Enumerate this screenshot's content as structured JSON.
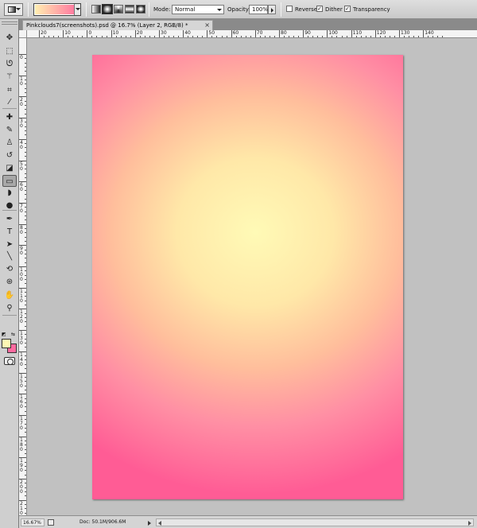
{
  "options_bar": {
    "tool_preset_icon": "gradient-tool-icon",
    "gradient_picker": {
      "start_color": "#ffeeb0",
      "end_color": "#ff7aa0"
    },
    "gradient_types": [
      "linear",
      "radial",
      "angle",
      "reflected",
      "diamond"
    ],
    "selected_gradient_type": "radial",
    "mode_label": "Mode:",
    "mode_value": "Normal",
    "opacity_label": "Opacity:",
    "opacity_value": "100%",
    "reverse_label": "Reverse",
    "reverse_checked": false,
    "dither_label": "Dither",
    "dither_checked": true,
    "transparency_label": "Transparency",
    "transparency_checked": true,
    "check_mark": "✓"
  },
  "document_tab": {
    "title": "Pinkclouds7(screenshots).psd @ 16.7% (Layer 2, RGB/8) *",
    "close_glyph": "×"
  },
  "toolbox": {
    "tools": [
      {
        "name": "move",
        "glyph": "✥"
      },
      {
        "name": "marquee",
        "glyph": "⬚"
      },
      {
        "name": "lasso",
        "glyph": "ᘎ"
      },
      {
        "name": "magic-wand",
        "glyph": "⚚"
      },
      {
        "name": "crop",
        "glyph": "⌗"
      },
      {
        "name": "eyedropper",
        "glyph": "⁄"
      },
      {
        "name": "healing-brush",
        "glyph": "✚"
      },
      {
        "name": "brush",
        "glyph": "✎"
      },
      {
        "name": "clone-stamp",
        "glyph": "♙"
      },
      {
        "name": "history-brush",
        "glyph": "↺"
      },
      {
        "name": "eraser",
        "glyph": "◪"
      },
      {
        "name": "gradient",
        "glyph": "▭"
      },
      {
        "name": "blur",
        "glyph": "◗"
      },
      {
        "name": "dodge",
        "glyph": "●"
      },
      {
        "name": "pen",
        "glyph": "✒"
      },
      {
        "name": "type",
        "glyph": "T"
      },
      {
        "name": "path-selection",
        "glyph": "➤"
      },
      {
        "name": "line",
        "glyph": "╲"
      },
      {
        "name": "3d-rotate",
        "glyph": "⟲"
      },
      {
        "name": "3d-orbit",
        "glyph": "⊛"
      },
      {
        "name": "hand",
        "glyph": "✋"
      },
      {
        "name": "zoom",
        "glyph": "⚲"
      }
    ],
    "active_tool": "gradient",
    "foreground_color": "#fff8b4",
    "background_color": "#ff6aa0",
    "swap_glyph": "⇆",
    "default_colors_glyph": "◩"
  },
  "rulers": {
    "horizontal_labels": [
      "20",
      "10",
      "0",
      "10",
      "20",
      "30",
      "40",
      "50",
      "60",
      "70",
      "80",
      "90",
      "100",
      "110",
      "120",
      "130",
      "140"
    ],
    "vertical_labels": [
      "0",
      "10",
      "20",
      "30",
      "40",
      "50",
      "60",
      "70",
      "80",
      "90",
      "100",
      "110",
      "120",
      "130",
      "140",
      "150",
      "160",
      "170",
      "180",
      "190",
      "200",
      "210"
    ]
  },
  "canvas": {
    "gradient_center_color": "#fffab6",
    "gradient_edge_color": "#ff5c95",
    "pasteboard_color": "#c1c1c1"
  },
  "status_bar": {
    "zoom": "16.67%",
    "doc_info": "Doc: 50.1M/906.6M"
  }
}
